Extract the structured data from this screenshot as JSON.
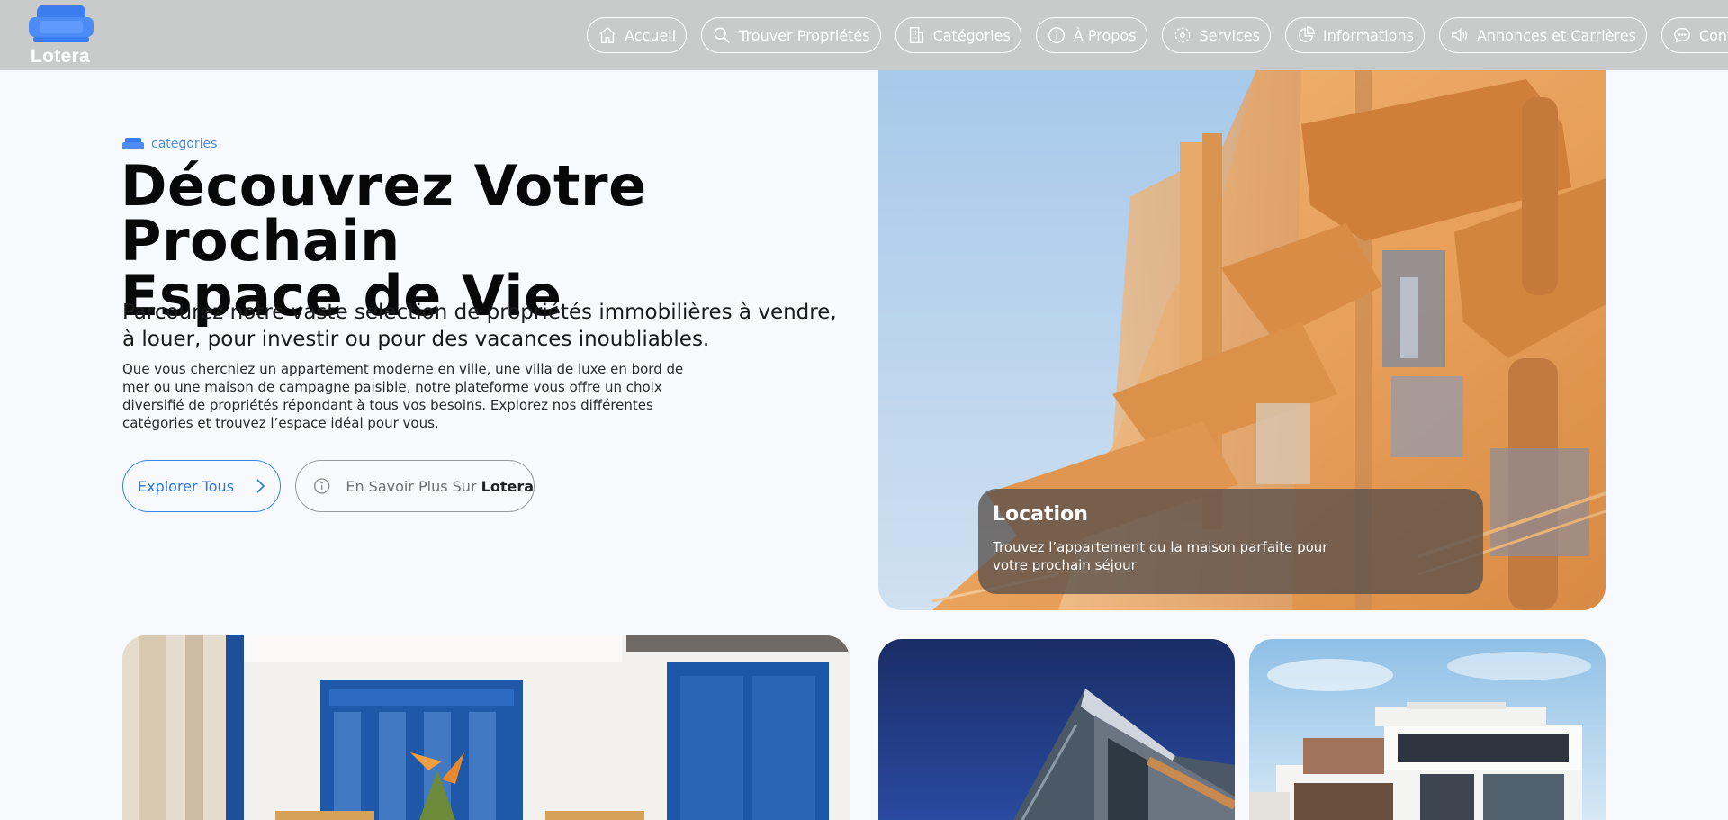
{
  "brand": {
    "name": "Lotera",
    "color": "#3b7cf0"
  },
  "nav": [
    {
      "label": "Accueil",
      "icon": "home-icon"
    },
    {
      "label": "Trouver Propriétés",
      "icon": "search-icon"
    },
    {
      "label": "Catégories",
      "icon": "building-icon"
    },
    {
      "label": "À Propos",
      "icon": "info-icon"
    },
    {
      "label": "Services",
      "icon": "services-icon"
    },
    {
      "label": "Informations",
      "icon": "chart-pie-icon"
    },
    {
      "label": "Annonces et Carrières",
      "icon": "megaphone-icon"
    },
    {
      "label": "Contact",
      "icon": "chat-icon"
    }
  ],
  "hero": {
    "eyebrow": "categories",
    "title_line1": "Découvrez Votre Prochain",
    "title_line2": "Espace de Vie",
    "subtitle": "Parcourez notre vaste sélection de propriétés immobilières à vendre, à louer, pour investir ou pour des vacances inoubliables.",
    "description": "Que vous cherchiez un appartement moderne en ville, une villa de luxe en bord de mer ou une maison de campagne paisible, notre plateforme vous offre un choix diversifié de propriétés répondant à tous vos besoins. Explorez nos différentes catégories et trouvez l’espace idéal pour vous.",
    "primary_button": "Explorer Tous",
    "secondary_button_prefix": "En Savoir Plus Sur",
    "secondary_button_brand": "Lotera"
  },
  "feature_card": {
    "title": "Location",
    "text": "Trouvez l’appartement ou la maison parfaite pour votre prochain séjour"
  },
  "colors": {
    "header_bg": "#c9cbcb",
    "accent_blue": "#3d86e0",
    "page_bg": "#f8f9fd"
  }
}
